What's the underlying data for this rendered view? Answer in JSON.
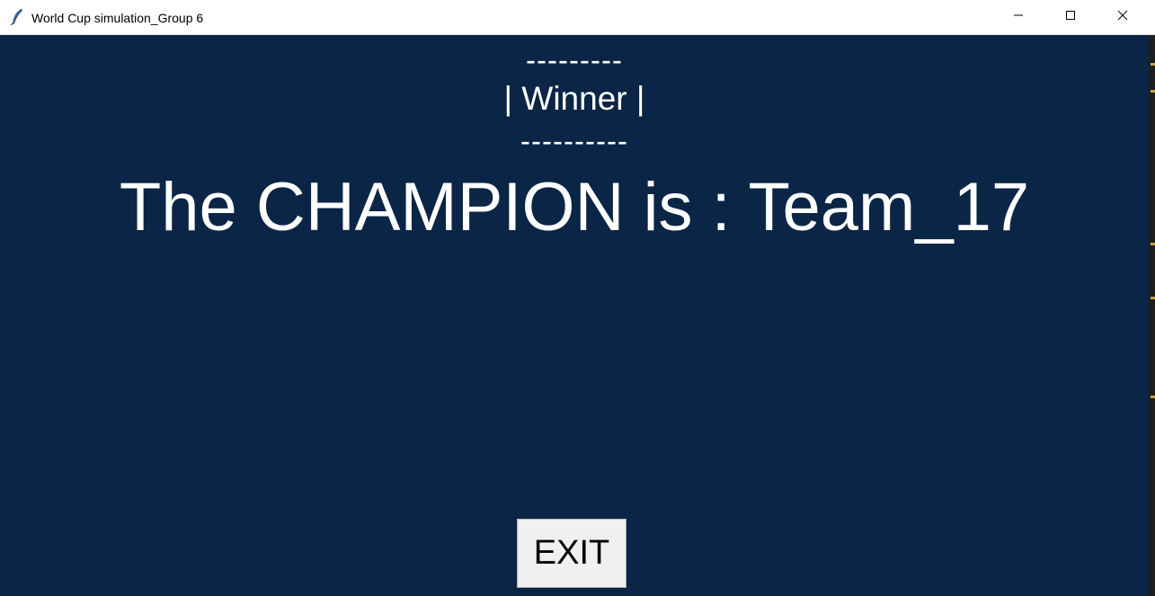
{
  "window": {
    "title": "World Cup simulation_Group 6",
    "controls": {
      "minimize": "minimize-icon",
      "maximize": "maximize-icon",
      "close": "close-icon"
    }
  },
  "result": {
    "dash_top": "---------",
    "winner_label": "| Winner |",
    "dash_bottom": "----------",
    "champion_text": "The CHAMPION is : Team_17"
  },
  "actions": {
    "exit_label": "EXIT"
  },
  "colors": {
    "background": "#0a2545",
    "text": "#ffffff",
    "button_bg": "#f0f0f0"
  }
}
